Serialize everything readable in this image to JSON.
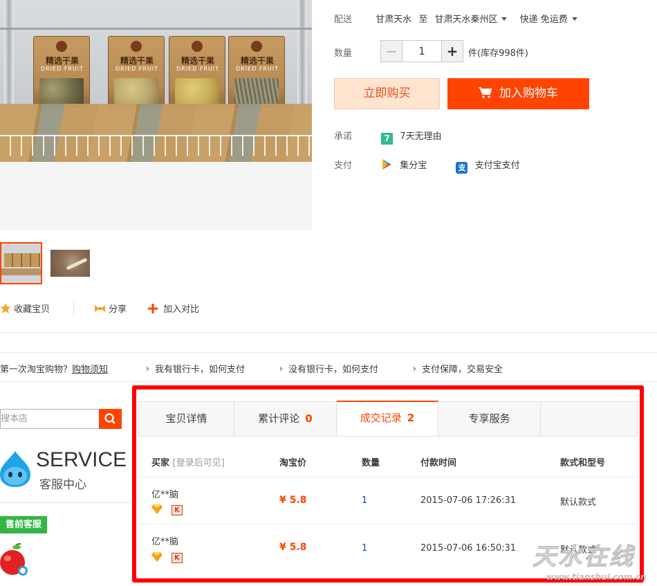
{
  "product_image": {
    "bags": [
      {
        "title": "精选干果",
        "subtitle": "DRIED FRUIT"
      },
      {
        "title": "精选干果",
        "subtitle": "DRIED FRUIT"
      },
      {
        "title": "精选干果",
        "subtitle": "DRIED FRUIT"
      },
      {
        "title": "精选干果",
        "subtitle": "DRIED FRUIT"
      }
    ]
  },
  "delivery": {
    "label": "配送",
    "from": "甘肃天水",
    "to_word": "至",
    "destination": "甘肃天水秦州区",
    "shipping": "快递 免运费"
  },
  "quantity": {
    "label": "数量",
    "minus": "−",
    "value": "1",
    "plus": "+",
    "stock": "件(库存998件)"
  },
  "buttons": {
    "buy_now": "立即购买",
    "add_to_cart": "加入购物车"
  },
  "promise": {
    "label": "承诺",
    "icon_text": "7",
    "text": "7天无理由"
  },
  "payment": {
    "label": "支付",
    "method1": "集分宝",
    "method2_icon": "支",
    "method2": "支付宝支付"
  },
  "actions": {
    "favorite": "收藏宝贝",
    "share": "分享",
    "compare": "加入对比"
  },
  "help_bar": {
    "first_time": "第一次淘宝购物？",
    "guide_link": "购物须知",
    "item1": "我有银行卡，如何支付",
    "item2": "没有银行卡，如何支付",
    "item3": "支付保障，交易安全"
  },
  "sidebar": {
    "search_placeholder": "搜本店",
    "service_word": "SERVICE",
    "service_sub": "客服中心",
    "presale": "售前客服"
  },
  "tabs": [
    {
      "label": "宝贝详情",
      "count": ""
    },
    {
      "label": "累计评论",
      "count": "0"
    },
    {
      "label": "成交记录",
      "count": "2"
    },
    {
      "label": "专享服务",
      "count": ""
    }
  ],
  "records": {
    "headers": {
      "buyer": "买家",
      "buyer_note": "[登录后可见]",
      "price": "淘宝价",
      "qty": "数量",
      "time": "付款时间",
      "style": "款式和型号"
    },
    "rows": [
      {
        "buyer": "亿**脑",
        "price": "¥ 5.8",
        "qty": "1",
        "time": "2015-07-06 17:26:31",
        "style": "默认款式",
        "badge": "K"
      },
      {
        "buyer": "亿**脑",
        "price": "¥ 5.8",
        "qty": "1",
        "time": "2015-07-06 16:50:31",
        "style": "默认款式",
        "badge": "K"
      }
    ]
  },
  "watermark": {
    "main": "天水在线",
    "url": "www.tianshui.com.cn"
  },
  "colors": {
    "accent": "#ff4400",
    "highlight_frame": "#ff0000",
    "promise_green": "#2fbc8e",
    "presale_green": "#33b544"
  }
}
